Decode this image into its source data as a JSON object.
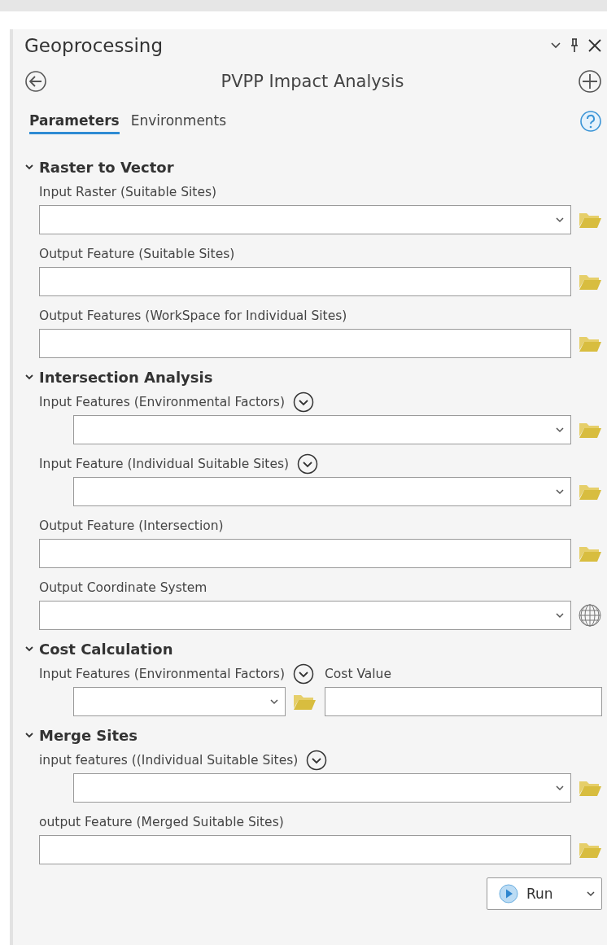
{
  "pane": {
    "title": "Geoprocessing"
  },
  "tool": {
    "title": "PVPP Impact Analysis"
  },
  "tabs": [
    {
      "label": "Parameters",
      "selected": true
    },
    {
      "label": "Environments",
      "selected": false
    }
  ],
  "sections": [
    {
      "title": "Raster to Vector",
      "expanded": true,
      "kind": "stack",
      "params": [
        {
          "label": "Input Raster (Suitable Sites)",
          "kind": "dropdown",
          "multi": false,
          "browse": true,
          "globe": false
        },
        {
          "label": "Output Feature (Suitable Sites)",
          "kind": "text",
          "multi": false,
          "browse": true,
          "globe": false
        },
        {
          "label": "Output Features (WorkSpace for Individual Sites)",
          "kind": "text",
          "multi": false,
          "browse": true,
          "globe": false
        }
      ]
    },
    {
      "title": "Intersection Analysis",
      "expanded": true,
      "kind": "stack",
      "params": [
        {
          "label": "Input Features (Environmental Factors)",
          "kind": "dropdown",
          "multi": true,
          "browse": true,
          "globe": false
        },
        {
          "label": "Input Feature (Individual Suitable Sites)",
          "kind": "dropdown",
          "multi": true,
          "browse": true,
          "globe": false
        },
        {
          "label": "Output Feature (Intersection)",
          "kind": "text",
          "multi": false,
          "browse": true,
          "globe": false
        },
        {
          "label": "Output Coordinate System",
          "kind": "dropdown",
          "multi": false,
          "browse": false,
          "globe": true
        }
      ]
    },
    {
      "title": "Cost Calculation",
      "expanded": true,
      "kind": "columns",
      "params": [
        {
          "label": "Input Features (Environmental Factors)",
          "kind": "dropdown",
          "multi": true,
          "browse": true,
          "globe": false
        },
        {
          "label": "Cost Value",
          "kind": "text",
          "multi": false,
          "browse": false,
          "globe": false
        }
      ]
    },
    {
      "title": "Merge Sites",
      "expanded": true,
      "kind": "stack",
      "params": [
        {
          "label": "input features ((Individual Suitable Sites)",
          "kind": "dropdown",
          "multi": true,
          "browse": true,
          "globe": false
        },
        {
          "label": "output Feature (Merged Suitable Sites)",
          "kind": "text",
          "multi": false,
          "browse": true,
          "globe": false
        }
      ]
    }
  ],
  "run_button": {
    "label": "Run"
  }
}
